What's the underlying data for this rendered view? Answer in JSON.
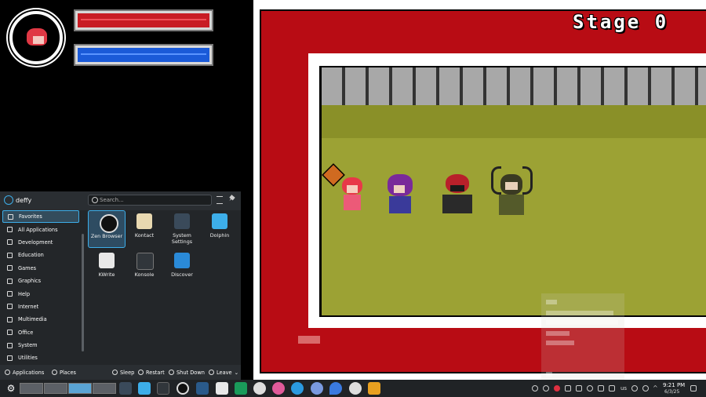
{
  "game": {
    "stage_title": "Stage 0"
  },
  "launcher": {
    "username": "deffy",
    "search_placeholder": "Search...",
    "categories": [
      {
        "label": "Favorites",
        "icon": "star-icon"
      },
      {
        "label": "All Applications",
        "icon": "grid-icon"
      },
      {
        "label": "Development",
        "icon": "wrench-icon"
      },
      {
        "label": "Education",
        "icon": "book-icon"
      },
      {
        "label": "Games",
        "icon": "gamepad-icon"
      },
      {
        "label": "Graphics",
        "icon": "palette-icon"
      },
      {
        "label": "Help",
        "icon": "help-icon"
      },
      {
        "label": "Internet",
        "icon": "globe-icon"
      },
      {
        "label": "Multimedia",
        "icon": "media-icon"
      },
      {
        "label": "Office",
        "icon": "document-icon"
      },
      {
        "label": "System",
        "icon": "gear-icon"
      },
      {
        "label": "Utilities",
        "icon": "toolbox-icon"
      }
    ],
    "apps": [
      {
        "label": "Zen Browser",
        "icon": "zen-browser-icon",
        "color": "#111111"
      },
      {
        "label": "Kontact",
        "icon": "kontact-icon",
        "color": "#e8d8b0"
      },
      {
        "label": "System Settings",
        "icon": "settings-icon",
        "color": "#3a4a5a"
      },
      {
        "label": "Dolphin",
        "icon": "folder-icon",
        "color": "#3daee9"
      },
      {
        "label": "KWrite",
        "icon": "text-editor-icon",
        "color": "#e8e8e8"
      },
      {
        "label": "Konsole",
        "icon": "terminal-icon",
        "color": "#31363b"
      },
      {
        "label": "Discover",
        "icon": "store-icon",
        "color": "#2a8ad8"
      }
    ],
    "footer": {
      "applications": "Applications",
      "places": "Places",
      "sleep": "Sleep",
      "restart": "Restart",
      "shutdown": "Shut Down",
      "leave": "Leave"
    }
  },
  "taskbar": {
    "time": "9:21 PM",
    "date": "6/3/25",
    "keyboard_layout": "us"
  },
  "colors": {
    "accent": "#3daee9",
    "hp": "#c81c24",
    "mp": "#1a5ad8",
    "frame_red": "#b80c14",
    "floor": "#9ca234"
  }
}
